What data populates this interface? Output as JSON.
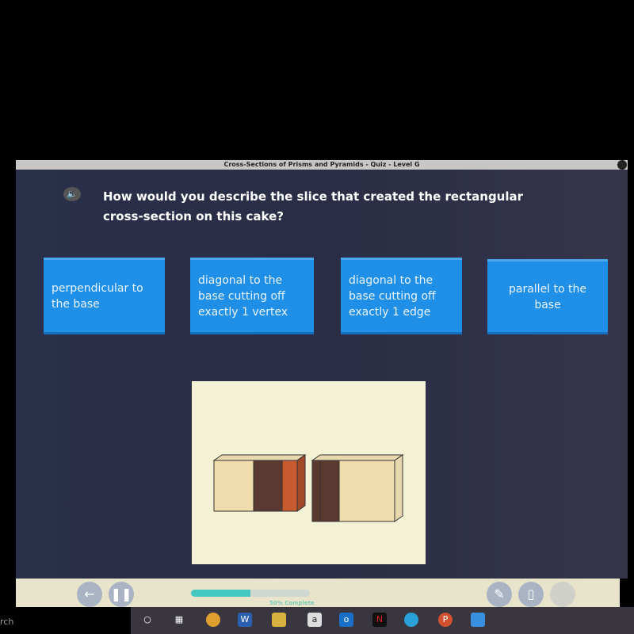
{
  "window": {
    "title": "Cross-Sections of Prisms and Pyramids - Quiz - Level G"
  },
  "question": {
    "text": "How would you describe the slice that created the rectangular cross-section on this cake?"
  },
  "answers": [
    {
      "label": "perpendicular to the base"
    },
    {
      "label": "diagonal to the base cutting off exactly 1 vertex"
    },
    {
      "label": "diagonal to the base cutting off exactly 1 edge"
    },
    {
      "label": "parallel to the base"
    }
  ],
  "progress": {
    "percent": 50,
    "label": "50% Complete"
  },
  "taskbar": {
    "search_fragment": "rch",
    "items": [
      "cortana",
      "task-view",
      "chrome",
      "word",
      "file-explorer",
      "amazon",
      "outlook",
      "netflix",
      "edge",
      "powerpoint",
      "zoom"
    ],
    "word_letter": "W",
    "amazon_letter": "a",
    "outlook_letter": "o",
    "netflix_letter": "N",
    "powerpoint_letter": "P"
  },
  "colors": {
    "answer_card": "#1f8fe8",
    "background": "#2a2f4a",
    "progress": "#45c8c0"
  }
}
